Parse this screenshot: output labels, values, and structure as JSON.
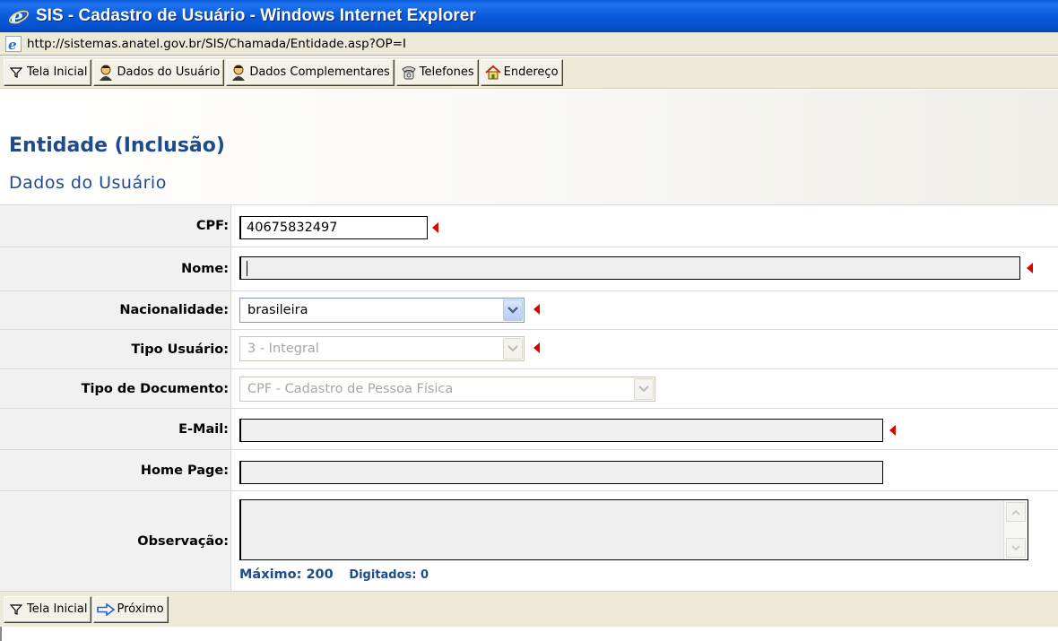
{
  "window": {
    "title": "SIS - Cadastro de Usuário - Windows Internet Explorer",
    "address": "http://sistemas.anatel.gov.br/SIS/Chamada/Entidade.asp?OP=I"
  },
  "toolbar_top": {
    "tela_inicial": "Tela Inicial",
    "dados_usuario": "Dados do Usuário",
    "dados_complementares": "Dados Complementares",
    "telefones": "Telefones",
    "endereco": "Endereço"
  },
  "page": {
    "title": "Entidade (Inclusão)",
    "subtitle": "Dados do Usuário"
  },
  "form": {
    "cpf": {
      "label": "CPF:",
      "value": "40675832497"
    },
    "nome": {
      "label": "Nome:",
      "value": ""
    },
    "nacionalidade": {
      "label": "Nacionalidade:",
      "value": "brasileira"
    },
    "tipo_usuario": {
      "label": "Tipo Usuário:",
      "value": "3 - Integral"
    },
    "tipo_documento": {
      "label": "Tipo de Documento:",
      "value": "CPF - Cadastro de Pessoa Física"
    },
    "email": {
      "label": "E-Mail:",
      "value": ""
    },
    "home_page": {
      "label": "Home Page:",
      "value": ""
    },
    "observacao": {
      "label": "Observação:",
      "value": "",
      "max_label": "Máximo: 200",
      "typed_label": "Digitados: 0"
    }
  },
  "toolbar_bottom": {
    "tela_inicial": "Tela Inicial",
    "proximo": "Próximo"
  },
  "colors": {
    "heading": "#1e4b8c",
    "required_marker": "#e00000",
    "titlebar": "#0a5ada"
  }
}
